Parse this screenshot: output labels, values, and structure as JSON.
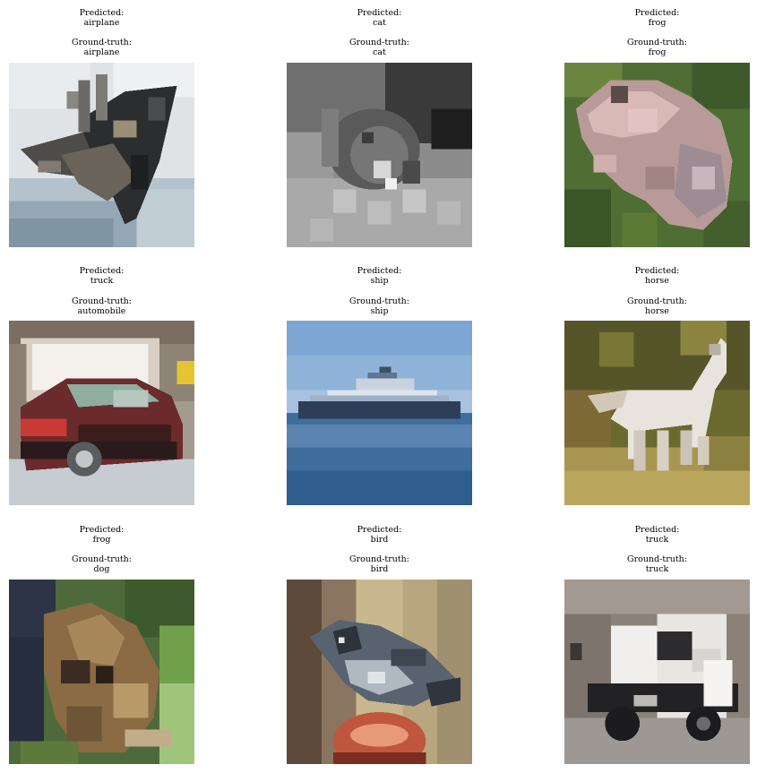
{
  "labels": {
    "predicted": "Predicted:",
    "ground_truth": "Ground-truth:"
  },
  "samples": [
    {
      "predicted": "airplane",
      "ground_truth": "airplane",
      "subject": "airplane-image"
    },
    {
      "predicted": "cat",
      "ground_truth": "cat",
      "subject": "cat-image"
    },
    {
      "predicted": "frog",
      "ground_truth": "frog",
      "subject": "frog-image"
    },
    {
      "predicted": "truck",
      "ground_truth": "automobile",
      "subject": "automobile-image"
    },
    {
      "predicted": "ship",
      "ground_truth": "ship",
      "subject": "ship-image"
    },
    {
      "predicted": "horse",
      "ground_truth": "horse",
      "subject": "horse-image"
    },
    {
      "predicted": "frog",
      "ground_truth": "dog",
      "subject": "dog-image"
    },
    {
      "predicted": "bird",
      "ground_truth": "bird",
      "subject": "bird-image"
    },
    {
      "predicted": "truck",
      "ground_truth": "truck",
      "subject": "truck-image"
    }
  ]
}
